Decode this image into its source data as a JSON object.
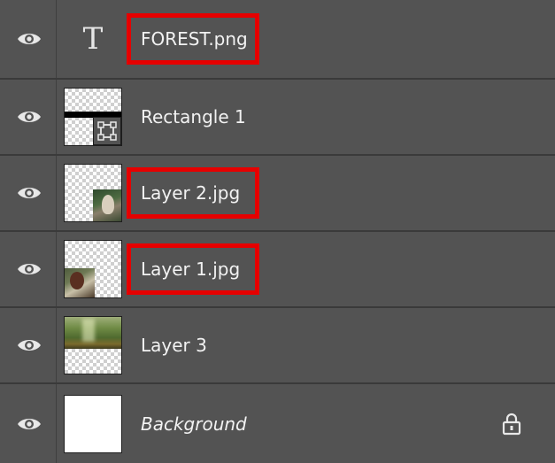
{
  "layers_panel": {
    "layers": [
      {
        "name": "FOREST.png",
        "kind": "type",
        "type_icon_glyph": "T",
        "visible": true,
        "highlighted": true
      },
      {
        "name": "Rectangle 1",
        "kind": "shape",
        "visible": true,
        "highlighted": false
      },
      {
        "name": "Layer 2.jpg",
        "kind": "image",
        "visible": true,
        "highlighted": true
      },
      {
        "name": "Layer 1.jpg",
        "kind": "image",
        "visible": true,
        "highlighted": true
      },
      {
        "name": "Layer 3",
        "kind": "image",
        "visible": true,
        "highlighted": false
      },
      {
        "name": "Background",
        "kind": "background",
        "visible": true,
        "locked": true,
        "highlighted": false
      }
    ],
    "icons": {
      "visibility": "eye-icon",
      "lock": "lock-icon",
      "type_layer": "type-layer-icon",
      "shape_badge": "shape-path-icon"
    },
    "colors": {
      "panel_bg": "#535353",
      "divider": "#3a3a3a",
      "text": "#f2f2f2",
      "highlight": "#e60000"
    }
  }
}
